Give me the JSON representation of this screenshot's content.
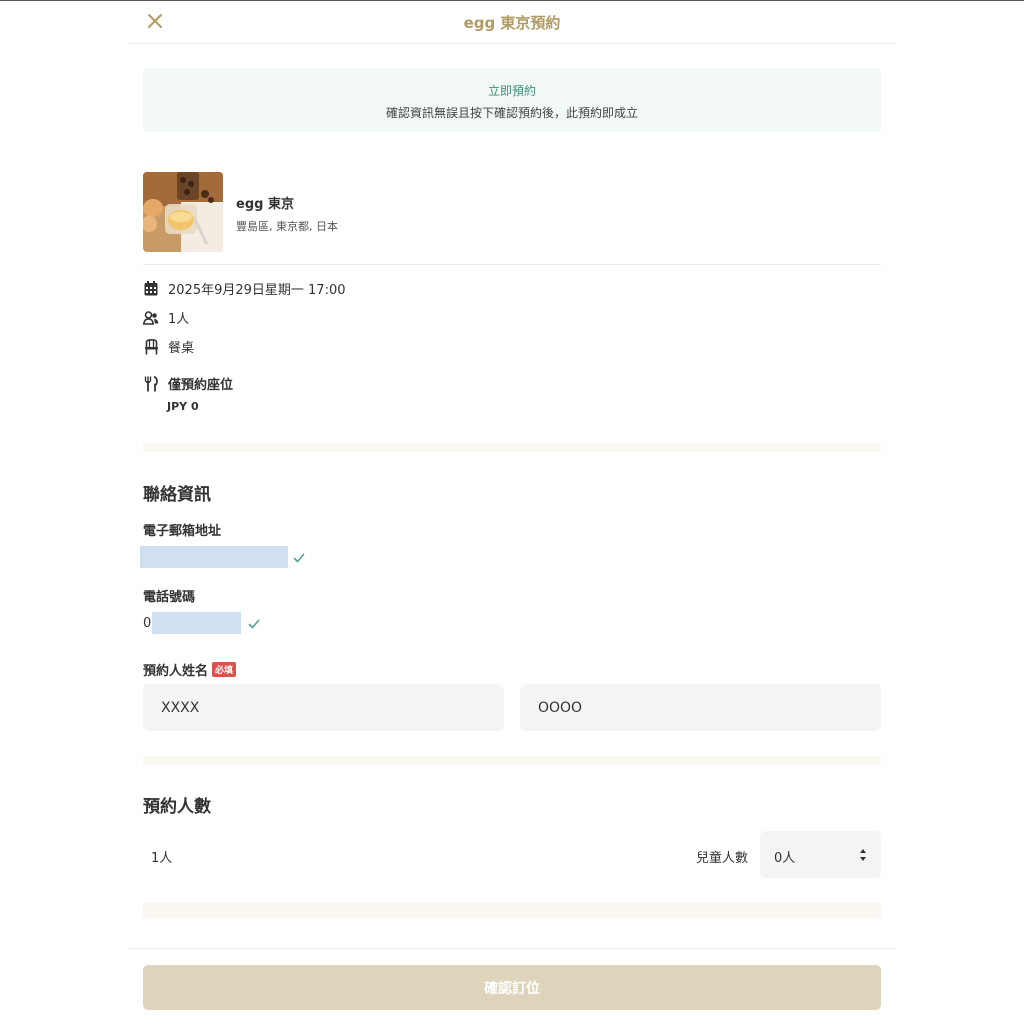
{
  "header": {
    "title": "egg 東京預約",
    "close_icon": "close-icon"
  },
  "banner": {
    "title": "立即預約",
    "text": "確認資訊無誤且按下確認預約後，此預約即成立"
  },
  "venue": {
    "name": "egg 東京",
    "address": "豐島區, 東京都, 日本"
  },
  "booking": {
    "datetime": "2025年9月29日星期一 17:00",
    "party": "1人",
    "seating": "餐桌",
    "plan": "僅預約座位",
    "price": "JPY 0"
  },
  "contact": {
    "title": "聯絡資訊",
    "email_label": "電子郵箱地址",
    "phone_label": "電話號碼",
    "phone_prefix": "0",
    "name_label": "預約人姓名",
    "required_badge": "必填",
    "last_name": "XXXX",
    "first_name": "OOOO"
  },
  "party": {
    "title": "預約人數",
    "adults": "1人",
    "children_label": "兒童人數",
    "children_value": "0人"
  },
  "footer": {
    "confirm_label": "確認訂位"
  },
  "colors": {
    "accent": "#b29a63",
    "banner_bg": "#f1f8f6",
    "banner_title": "#3f8f7b",
    "confirm_button": "#ddd4bb",
    "required_badge": "#d9534f",
    "check": "#4fa58f"
  }
}
